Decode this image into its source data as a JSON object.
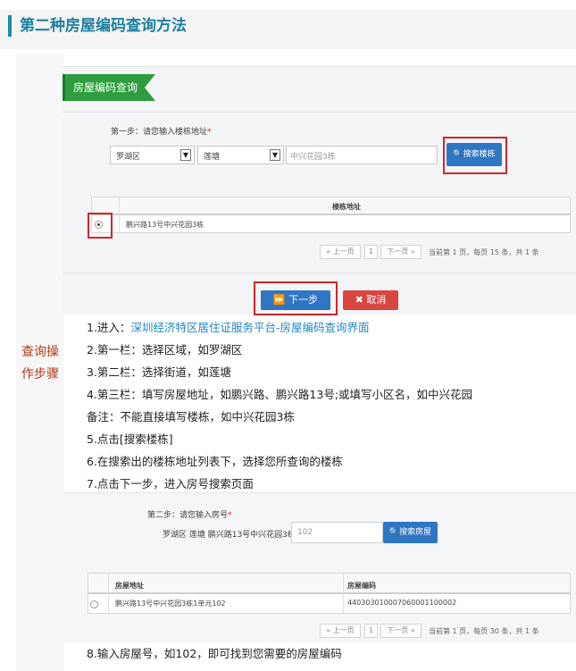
{
  "header": {
    "title": "第二种房屋编码查询方法"
  },
  "side_label": "查询操作步骤",
  "screenshot1": {
    "tag": "房屋编码查询",
    "step_label": "第一步：请您输入楼栋地址",
    "required_mark": "*",
    "district": "罗湖区",
    "street": "莲塘",
    "address_input": "中兴花园3栋",
    "search_button": "搜索楼栋",
    "table": {
      "header": "楼栋地址",
      "rows": [
        "鹏兴路13号中兴花园3栋"
      ]
    },
    "pager": {
      "prev": "« 上一页",
      "page": "1",
      "next": "下一页 »",
      "info": "当前第  1  页，每页 15 条，共 1 条"
    },
    "next_button": "下一步",
    "cancel_button": "取消"
  },
  "steps": [
    {
      "prefix": "1.进入：",
      "link": "深圳经济特区居住证服务平台-房屋编码查询界面"
    },
    {
      "text": "2.第一栏：选择区域，如罗湖区"
    },
    {
      "text": "3.第二栏：选择街道，如莲塘"
    },
    {
      "text": "4.第三栏：填写房屋地址，如鹏兴路、鹏兴路13号;或填写小区名，如中兴花园"
    },
    {
      "text": "备注：不能直接填写楼栋，如中兴花园3栋"
    },
    {
      "text": "5.点击[搜索楼栋]"
    },
    {
      "text": "6.在搜索出的楼栋地址列表下，选择您所查询的楼栋"
    },
    {
      "text": "7.点击下一步，进入房号搜索页面"
    }
  ],
  "screenshot2": {
    "step_label": "第二步：请您输入房号",
    "required_mark": "*",
    "address": "罗湖区 莲塘 鹏兴路13号中兴花园3栋",
    "room_input": "102",
    "search_button": "搜索房屋",
    "table": {
      "col1": "房屋地址",
      "col2": "房屋编码",
      "rows": [
        {
          "address": "鹏兴路13号中兴花园3栋1单元102",
          "code": "440303010007060001100002"
        }
      ]
    },
    "pager": {
      "prev": "« 上一页",
      "page": "1",
      "next": "下一页 »",
      "info": "当前第  1  页，每页 30 条，共 1 条"
    }
  },
  "final_step": "8.输入房屋号，如102，即可找到您需要的房屋编码",
  "colors": {
    "accent": "#1e7fa0",
    "button_blue": "#2e76c4",
    "button_red": "#d9463f",
    "highlight": "#d4242a"
  }
}
